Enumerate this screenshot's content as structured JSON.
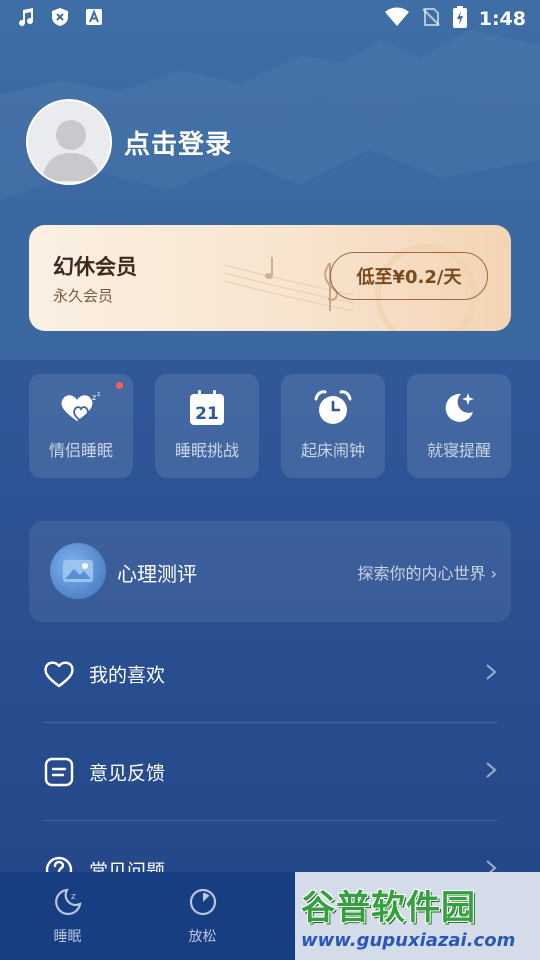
{
  "status_bar": {
    "time": "1:48"
  },
  "profile": {
    "login_text": "点击登录"
  },
  "vip_card": {
    "title": "幻休会员",
    "subtitle": "永久会员",
    "button_label": "低至¥0.2/天"
  },
  "tools": [
    {
      "label": "情侣睡眠",
      "icon": "couple-sleep-heart-icon",
      "badge": true
    },
    {
      "label": "睡眠挑战",
      "icon": "calendar-21-icon",
      "day": "21"
    },
    {
      "label": "起床闹钟",
      "icon": "alarm-clock-icon"
    },
    {
      "label": "就寝提醒",
      "icon": "moon-star-icon"
    }
  ],
  "psych_test": {
    "title": "心理测评",
    "link_text": "探索你的内心世界 ›"
  },
  "menu": [
    {
      "label": "我的喜欢",
      "icon": "heart-icon"
    },
    {
      "label": "意见反馈",
      "icon": "feedback-icon"
    },
    {
      "label": "常见问题",
      "icon": "question-icon"
    }
  ],
  "tabbar": [
    {
      "label": "睡眠",
      "icon": "moon-z-icon"
    },
    {
      "label": "放松",
      "icon": "relax-icon"
    }
  ],
  "watermark": {
    "title": "谷普软件园",
    "url": "www.gupuxiazai.com"
  },
  "colors": {
    "accent_red": "#ff5b5b",
    "vip_text": "#7a4a1f",
    "background": "#2b5193"
  }
}
